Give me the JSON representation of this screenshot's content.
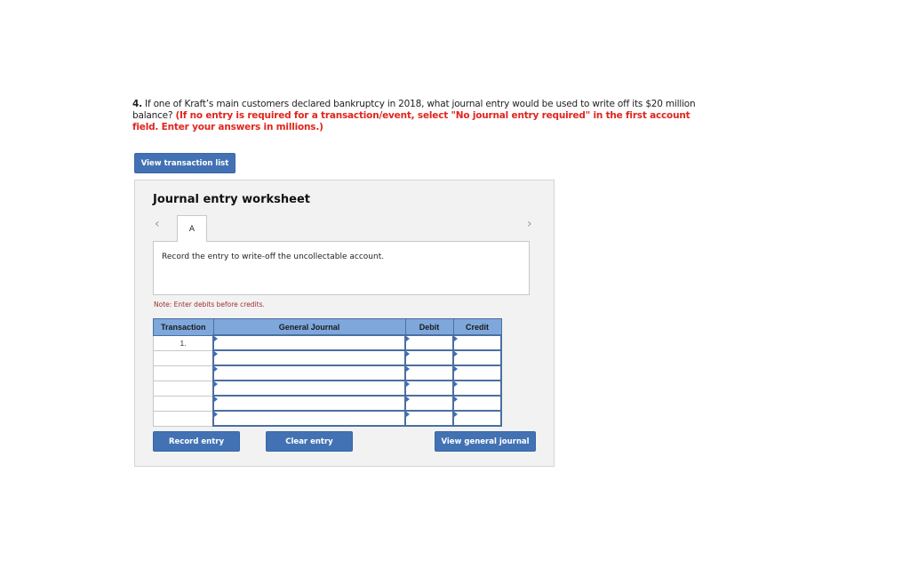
{
  "question": {
    "number": "4.",
    "text": " If one of Kraft’s main customers declared bankruptcy in 2018, what journal entry would be used to write off its $20 million balance? ",
    "instruction": "(If no entry is required for a transaction/event, select \"No journal entry required\" in the first account field. Enter your answers in millions.)"
  },
  "buttons": {
    "view_transaction_list": "View transaction list",
    "record_entry": "Record entry",
    "clear_entry": "Clear entry",
    "view_general_journal": "View general journal"
  },
  "worksheet": {
    "title": "Journal entry worksheet",
    "prev_icon": "‹",
    "next_icon": "›",
    "tabs": [
      {
        "label": "A",
        "active": true
      }
    ],
    "description": "Record the entry to write-off the uncollectable account.",
    "note": "Note: Enter debits before credits."
  },
  "journal_table": {
    "headers": [
      "Transaction",
      "General Journal",
      "Debit",
      "Credit"
    ],
    "rows": [
      {
        "transaction": "1.",
        "account": "",
        "debit": "",
        "credit": ""
      },
      {
        "transaction": "",
        "account": "",
        "debit": "",
        "credit": ""
      },
      {
        "transaction": "",
        "account": "",
        "debit": "",
        "credit": ""
      },
      {
        "transaction": "",
        "account": "",
        "debit": "",
        "credit": ""
      },
      {
        "transaction": "",
        "account": "",
        "debit": "",
        "credit": ""
      },
      {
        "transaction": "",
        "account": "",
        "debit": "",
        "credit": ""
      }
    ]
  },
  "colors": {
    "button_bg": "#4272b4",
    "instruction_red": "#e0261e",
    "header_blue": "#7ea7dc"
  }
}
